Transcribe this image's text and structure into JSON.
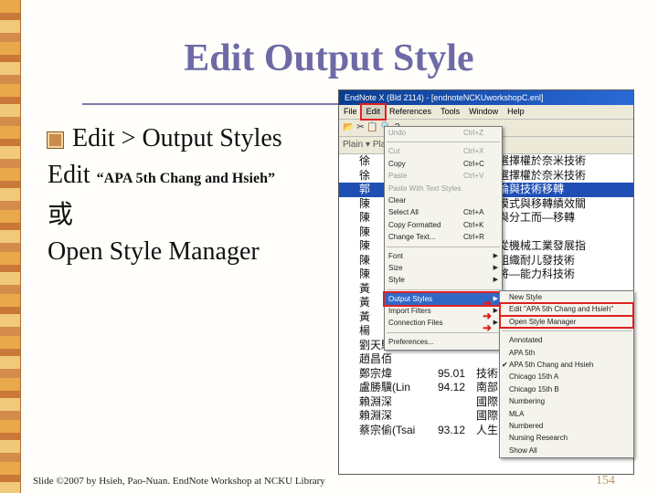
{
  "slide": {
    "title": "Edit Output Style",
    "bullet_lines": [
      "Edit > Output Styles",
      "Edit",
      "“APA 5th Chang and Hsieh”",
      "或",
      "Open Style Manager"
    ],
    "footer": "Slide ©2007 by Hsieh, Pao-Nuan.  EndNote Workshop at NCKU Library",
    "page_number": "154"
  },
  "window": {
    "title": "EndNote X (Bld 2114) - [endnoteNCKUworkshopC.enl]",
    "menus": [
      "File",
      "Edit",
      "References",
      "Tools",
      "Window",
      "Help"
    ],
    "active_menu_index": 1,
    "toolbar_text": "Plain  ▾  Plain  ▾   B  I  U  P  A¹  A₁  Σ",
    "toolbar_icons": "📂 ✂ 📋 🔍 ? ← →",
    "rows": [
      {
        "n": "徐",
        "y": "",
        "r": "實質選擇權於奈米技術"
      },
      {
        "n": "徐",
        "y": "",
        "r": "實質選擇權於奈米技術"
      },
      {
        "n": "郭",
        "y": "",
        "r": "管理論與技術移轉",
        "sel": true
      },
      {
        "n": "陳",
        "y": "",
        "r": "移轉模式與移轉績效關"
      },
      {
        "n": "陳",
        "y": "",
        "r": "評估與分工而—移轉"
      },
      {
        "n": "陳",
        "y": "",
        "r": ""
      },
      {
        "n": "陳",
        "y": "",
        "r": "部構從機械工業發展指"
      },
      {
        "n": "陳",
        "y": "",
        "r": "關生組織耐儿發技術"
      },
      {
        "n": "陳",
        "y": "",
        "r": "作製將—能力科技術"
      },
      {
        "n": "黃",
        "y": "",
        "r": ""
      },
      {
        "n": "黃",
        "y": "",
        "r": ""
      },
      {
        "n": "黃",
        "y": "",
        "r": ""
      },
      {
        "n": "楊",
        "y": "",
        "r": ""
      },
      {
        "n": "劉天驥",
        "y": "",
        "r": ""
      },
      {
        "n": "趙昌佰",
        "y": "",
        "r": ""
      },
      {
        "n": "鄭宗煒",
        "y": "95.01",
        "r": "技術"
      },
      {
        "n": "盧勝驥(Lin",
        "y": "94.12",
        "r": "南部"
      },
      {
        "n": "賴淵深",
        "y": "",
        "r": "國際"
      },
      {
        "n": "賴淵深",
        "y": "",
        "r": "國際"
      },
      {
        "n": "蔡宗偷(Tsai",
        "y": "93.12",
        "r": "人生"
      }
    ],
    "edit_menu": [
      {
        "label": "Undo",
        "shortcut": "Ctrl+Z",
        "disabled": true
      },
      {
        "sep": true
      },
      {
        "label": "Cut",
        "shortcut": "Ctrl+X",
        "disabled": true
      },
      {
        "label": "Copy",
        "shortcut": "Ctrl+C"
      },
      {
        "label": "Paste",
        "shortcut": "Ctrl+V",
        "disabled": true
      },
      {
        "label": "Paste With Text Styles",
        "shortcut": "",
        "disabled": true
      },
      {
        "label": "Clear",
        "shortcut": ""
      },
      {
        "label": "Select All",
        "shortcut": "Ctrl+A"
      },
      {
        "label": "Copy Formatted",
        "shortcut": "Ctrl+K"
      },
      {
        "label": "Change Text...",
        "shortcut": "Ctrl+R"
      },
      {
        "sep": true
      },
      {
        "label": "Font",
        "submenu": true
      },
      {
        "label": "Size",
        "submenu": true
      },
      {
        "label": "Style",
        "submenu": true
      },
      {
        "sep": true
      },
      {
        "label": "Output Styles",
        "submenu": true,
        "highlight": true
      },
      {
        "label": "Import Filters",
        "submenu": true
      },
      {
        "label": "Connection Files",
        "submenu": true
      },
      {
        "sep": true
      },
      {
        "label": "Preferences...",
        "shortcut": ""
      }
    ],
    "output_submenu": [
      {
        "label": "New Style"
      },
      {
        "label": "Edit \"APA 5th Chang and Hsieh\"",
        "boxed": true
      },
      {
        "label": "Open Style Manager",
        "boxed": true
      },
      {
        "sep": true
      },
      {
        "label": "Annotated"
      },
      {
        "label": "APA 5th"
      },
      {
        "label": "APA 5th Chang and Hsieh",
        "checked": true
      },
      {
        "label": "Chicago 15th A"
      },
      {
        "label": "Chicago 15th B"
      },
      {
        "label": "Numbering"
      },
      {
        "label": "MLA"
      },
      {
        "label": "Numbered"
      },
      {
        "label": "Nursing Research"
      },
      {
        "label": "Show All"
      }
    ]
  },
  "colors": {
    "title": "#6d6aa6",
    "highlight": "#3168c6",
    "callout": "#e02020"
  }
}
